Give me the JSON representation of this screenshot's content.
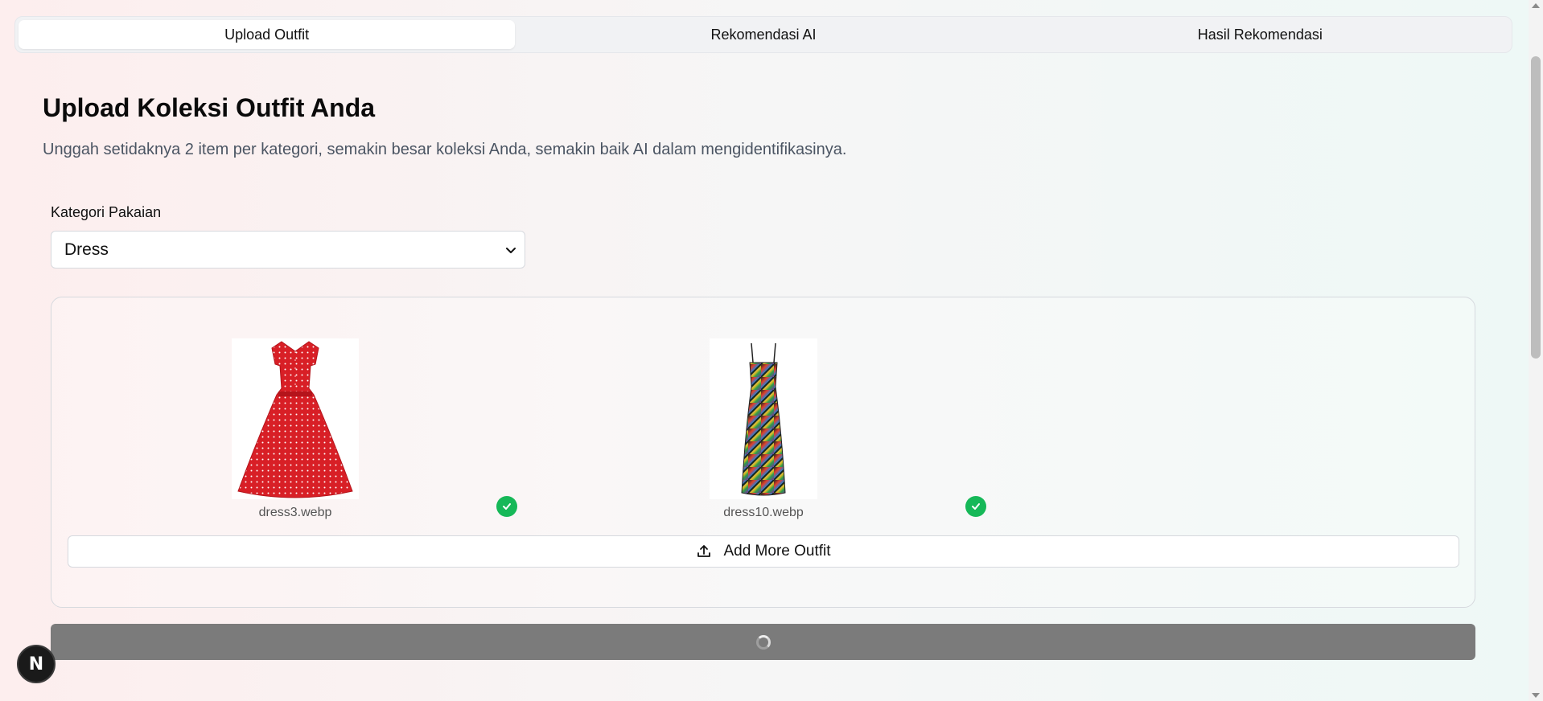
{
  "tabs": [
    {
      "label": "Upload Outfit",
      "active": true
    },
    {
      "label": "Rekomendasi AI",
      "active": false
    },
    {
      "label": "Hasil Rekomendasi",
      "active": false
    }
  ],
  "main": {
    "title": "Upload Koleksi Outfit Anda",
    "subtitle": "Unggah setidaknya 2 item per kategori, semakin besar koleksi Anda, semakin baik AI dalam mengidentifikasinya."
  },
  "category": {
    "label": "Kategori Pakaian",
    "selected": "Dress"
  },
  "uploads": [
    {
      "filename": "dress3.webp",
      "status": "uploaded"
    },
    {
      "filename": "dress10.webp",
      "status": "uploaded"
    }
  ],
  "add_button": {
    "label": "Add More Outfit",
    "icon": "upload-icon"
  },
  "submit": {
    "state": "loading"
  },
  "badge": {
    "letter": "N"
  },
  "colors": {
    "success": "#16b858",
    "submit_disabled": "#7b7b7b"
  }
}
